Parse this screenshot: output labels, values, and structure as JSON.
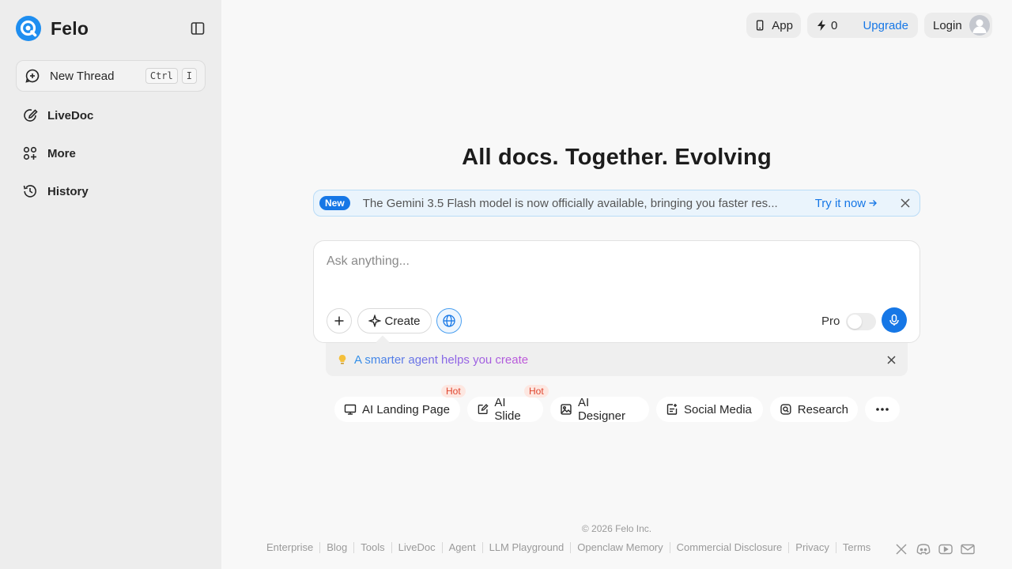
{
  "brand": {
    "name": "Felo"
  },
  "sidebar": {
    "new_thread": {
      "label": "New Thread",
      "shortcut_key1": "Ctrl",
      "shortcut_key2": "I"
    },
    "items": [
      {
        "label": "LiveDoc",
        "icon": "pencil-circle-icon"
      },
      {
        "label": "More",
        "icon": "apps-plus-icon"
      },
      {
        "label": "History",
        "icon": "history-icon"
      }
    ]
  },
  "topbar": {
    "app_label": "App",
    "credits": "0",
    "upgrade_label": "Upgrade",
    "login_label": "Login"
  },
  "main": {
    "headline": "All docs. Together. Evolving",
    "banner": {
      "badge": "New",
      "text": "The Gemini 3.5 Flash model is now officially available, bringing you faster res...",
      "link": "Try it now"
    },
    "ask": {
      "placeholder": "Ask anything...",
      "create_label": "Create",
      "pro_label": "Pro",
      "pro_enabled": false
    },
    "hint": {
      "text": "A smarter agent helps you create"
    },
    "chips": [
      {
        "label": "AI Landing Page",
        "badge": "Hot",
        "icon": "monitor-icon"
      },
      {
        "label": "AI Slide",
        "badge": "Hot",
        "icon": "slide-edit-icon"
      },
      {
        "label": "AI Designer",
        "badge": "",
        "icon": "image-icon"
      },
      {
        "label": "Social Media",
        "badge": "",
        "icon": "social-post-icon"
      },
      {
        "label": "Research",
        "badge": "",
        "icon": "research-icon"
      }
    ]
  },
  "footer": {
    "copyright": "© 2026  Felo Inc.",
    "links": [
      "Enterprise",
      "Blog",
      "Tools",
      "LiveDoc",
      "Agent",
      "LLM Playground",
      "Openclaw Memory",
      "Commercial Disclosure",
      "Privacy",
      "Terms"
    ],
    "socials": [
      "x-icon",
      "discord-icon",
      "youtube-icon",
      "mail-icon"
    ]
  },
  "colors": {
    "accent": "#1677e6",
    "sidebar_bg": "#ededed",
    "page_bg": "#f8f8f8",
    "hot_badge": "#e0452e"
  }
}
